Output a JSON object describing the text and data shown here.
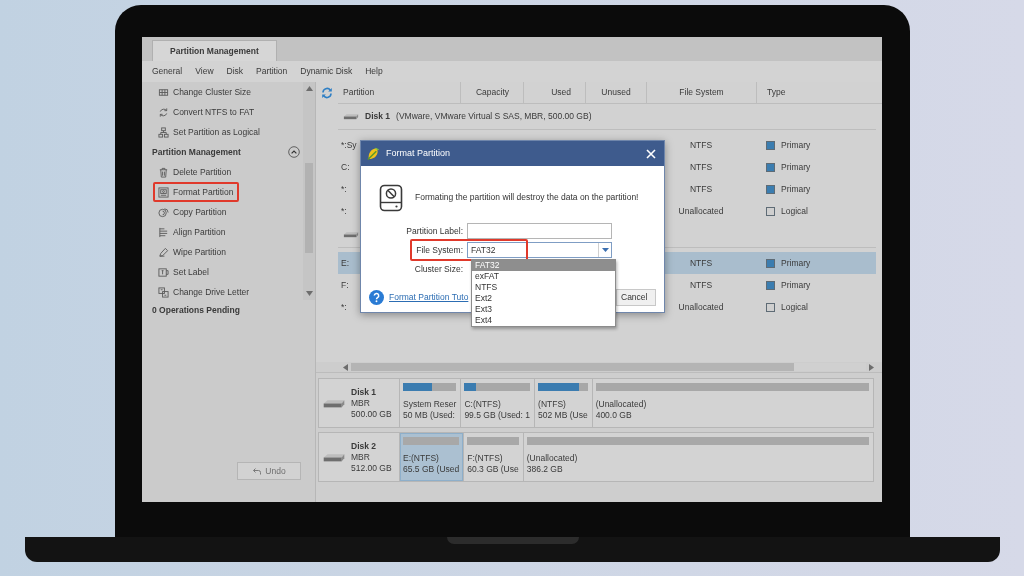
{
  "app": {
    "tabs": [
      {
        "label": "Partition Management",
        "selected": true
      }
    ],
    "menu": [
      "General",
      "View",
      "Disk",
      "Partition",
      "Dynamic Disk",
      "Help"
    ],
    "sidebar": {
      "items": [
        {
          "kind": "action",
          "label": "Change Cluster Size",
          "highlighted": false
        },
        {
          "kind": "action",
          "label": "Convert NTFS to FAT",
          "highlighted": false
        },
        {
          "kind": "action",
          "label": "Set Partition as Logical",
          "highlighted": false
        },
        {
          "kind": "group",
          "label": "Partition Management",
          "expanded": true
        },
        {
          "kind": "action",
          "label": "Delete Partition",
          "highlighted": false
        },
        {
          "kind": "action",
          "label": "Format Partition",
          "highlighted": true
        },
        {
          "kind": "action",
          "label": "Copy Partition",
          "highlighted": false
        },
        {
          "kind": "action",
          "label": "Align Partition",
          "highlighted": false
        },
        {
          "kind": "action",
          "label": "Wipe Partition",
          "highlighted": false
        },
        {
          "kind": "action",
          "label": "Set Label",
          "highlighted": false
        },
        {
          "kind": "action",
          "label": "Change Drive Letter",
          "highlighted": false
        }
      ],
      "pending": "0 Operations Pending",
      "buttons": [
        {
          "label": "Undo",
          "disabled": true
        }
      ]
    },
    "partition_list": {
      "columns": [
        "Partition",
        "Capacity",
        "Used",
        "Unused",
        "File System",
        "Type"
      ],
      "rows": [
        {
          "kind": "disk",
          "name": "Disk 1",
          "detail": "(VMware, VMware Virtual S SAS, MBR, 500.00 GB)"
        },
        {
          "kind": "partition",
          "partition": "*:Sy",
          "file_system": "NTFS",
          "type": "Primary",
          "color": "#3b7db0",
          "selected": false
        },
        {
          "kind": "partition",
          "partition": "C:",
          "file_system": "NTFS",
          "type": "Primary",
          "color": "#3b7db0",
          "selected": false
        },
        {
          "kind": "partition",
          "partition": "*:",
          "file_system": "NTFS",
          "type": "Primary",
          "color": "#3b7db0",
          "selected": false
        },
        {
          "kind": "partition",
          "partition": "*:",
          "file_system": "Unallocated",
          "type": "Logical",
          "color": "#cfcfcf",
          "selected": false
        },
        {
          "kind": "disk"
        },
        {
          "kind": "partition",
          "partition": "E:",
          "file_system": "NTFS",
          "type": "Primary",
          "color": "#3b7db0",
          "selected": true
        },
        {
          "kind": "partition",
          "partition": "F:",
          "file_system": "NTFS",
          "type": "Primary",
          "color": "#3b7db0",
          "selected": false
        },
        {
          "kind": "partition",
          "partition": "*:",
          "file_system": "Unallocated",
          "type": "Logical",
          "color": "#cfcfcf",
          "selected": false
        }
      ]
    },
    "disk_map": [
      {
        "name": "Disk 1",
        "scheme": "MBR",
        "size": "500.00 GB",
        "partitions": [
          {
            "kind": "partition",
            "label": "System Reser",
            "detail": "50 MB (Used:",
            "level": 0.55,
            "selected": false
          },
          {
            "kind": "partition",
            "label": "C:(NTFS)",
            "detail": "99.5 GB (Used: 1",
            "level": 0.17,
            "selected": false
          },
          {
            "kind": "partition",
            "label": "(NTFS)",
            "detail": "502 MB (Use",
            "level": 0.82,
            "selected": false
          },
          {
            "kind": "unallocated",
            "label": "(Unallocated)",
            "detail": "400.0 GB",
            "selected": false
          }
        ]
      },
      {
        "name": "Disk 2",
        "scheme": "MBR",
        "size": "512.00 GB",
        "partitions": [
          {
            "kind": "partition",
            "label": "E:(NTFS)",
            "detail": "65.5 GB (Used",
            "selected": true
          },
          {
            "kind": "partition",
            "label": "F:(NTFS)",
            "detail": "60.3 GB (Use",
            "selected": false
          },
          {
            "kind": "unallocated",
            "label": "(Unallocated)",
            "detail": "386.2 GB",
            "selected": false
          }
        ]
      }
    ]
  },
  "dialog": {
    "title": "Format Partition",
    "warning": "Formating the partition will destroy the data on the partition!",
    "fields": [
      {
        "kind": "text",
        "label": "Partition Label:",
        "highlighted": false
      },
      {
        "kind": "select",
        "label": "File System:",
        "value": "FAT32",
        "highlighted": true,
        "expanded": true,
        "options": [
          {
            "label": "FAT32",
            "selected": true
          },
          {
            "label": "exFAT",
            "selected": false
          },
          {
            "label": "NTFS",
            "selected": false
          },
          {
            "label": "Ext2",
            "selected": false
          },
          {
            "label": "Ext3",
            "selected": false
          },
          {
            "label": "Ext4",
            "selected": false
          }
        ]
      },
      {
        "kind": "label",
        "label": "Cluster Size:",
        "highlighted": false
      }
    ],
    "help_link": "Format Partition Tuto",
    "buttons": [
      {
        "label": "Cancel"
      }
    ]
  }
}
